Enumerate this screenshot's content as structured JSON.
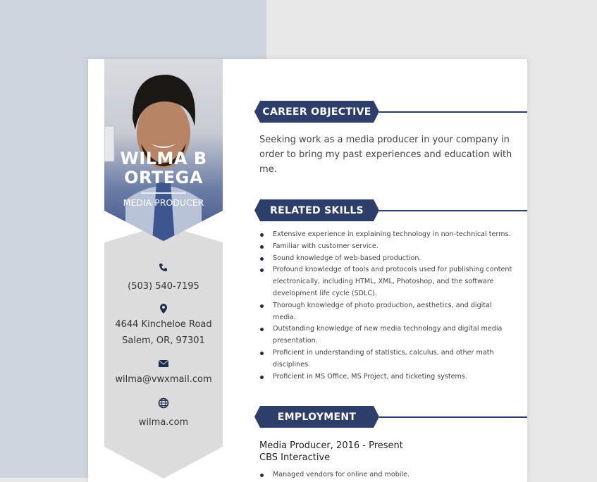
{
  "profile": {
    "name_line1": "WILMA B",
    "name_line2": "ORTEGA",
    "title": "MEDIA PRODUCER"
  },
  "contact": {
    "phone": "(503) 540-7195",
    "address_line1": "4644 Kincheloe Road",
    "address_line2": "Salem, OR, 97301",
    "email": "wilma@vwxmail.com",
    "website": "wilma.com"
  },
  "sections": {
    "career_objective": {
      "heading": "CAREER OBJECTIVE",
      "text": "Seeking work as a media producer in your company in order to bring my past experiences and education with me."
    },
    "related_skills": {
      "heading": "RELATED SKILLS",
      "items": [
        "Extensive experience in explaining technology in non-technical terms.",
        "Familiar with customer service.",
        "Sound knowledge of web-based production.",
        "Profound knowledge of tools and protocols used for publishing content electronically, including HTML, XML, Photoshop, and the software development life cycle (SDLC).",
        "Thorough knowledge of photo production, aesthetics, and digital media.",
        "Outstanding knowledge of new media technology and digital media presentation.",
        "Proficient in understanding of statistics, calculus, and other math disciplines.",
        "Proficient in MS Office, MS Project, and ticketing systems."
      ]
    },
    "employment": {
      "heading": "EMPLOYMENT",
      "job_title": "Media Producer, 2016 - Present",
      "company": "CBS Interactive",
      "items": [
        "Managed vendors for online and mobile."
      ]
    }
  },
  "colors": {
    "accent": "#2d3e6b",
    "sidebar_gray": "#dcdcdc"
  },
  "icons": [
    "phone-icon",
    "location-pin-icon",
    "envelope-icon",
    "globe-icon"
  ]
}
